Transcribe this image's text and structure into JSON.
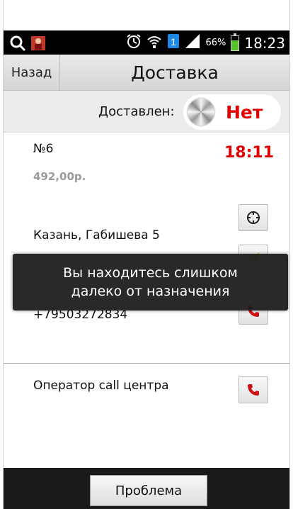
{
  "status_bar": {
    "time": "18:23",
    "battery": "66%",
    "battery_level": 0.66,
    "left_icons": [
      "search-icon",
      "app-notification-icon"
    ],
    "right_icons": [
      "alarm-icon",
      "wifi-icon",
      "data-icon",
      "signal-icon",
      "battery-icon"
    ]
  },
  "header": {
    "back_label": "Назад",
    "title": "Доставка"
  },
  "delivered": {
    "label": "Доставлен:",
    "toggle_value": "Нет"
  },
  "order": {
    "number": "№6",
    "time": "18:11",
    "price": "492,00р.",
    "address": "Казань, Габишева 5",
    "phone": "+79503272834"
  },
  "operator": {
    "label": "Оператор call центра"
  },
  "toast": {
    "line1": "Вы находитесь слишком",
    "line2": "далеко от назначения"
  },
  "footer": {
    "problem_label": "Проблема"
  },
  "colors": {
    "accent_red": "#e00000",
    "header_bg": "#dedede",
    "status_bar_bg": "#000000",
    "battery_green": "#59c22a"
  }
}
